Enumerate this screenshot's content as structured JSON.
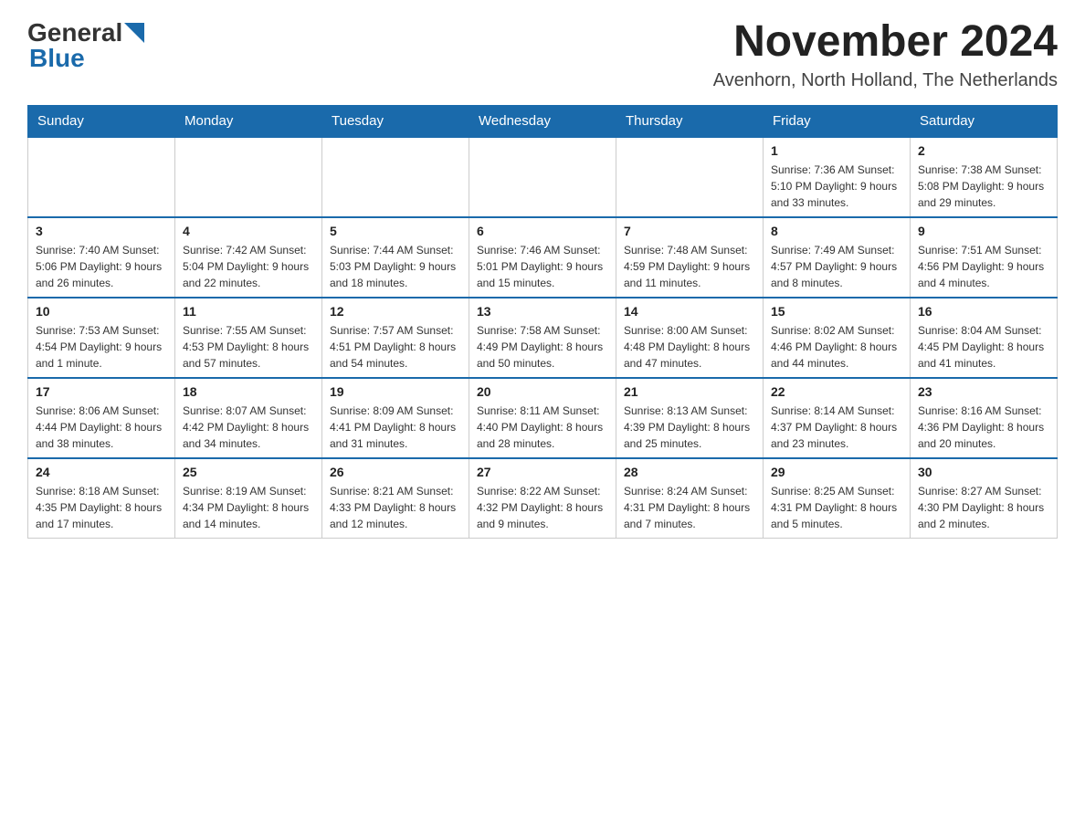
{
  "header": {
    "logo_general": "General",
    "logo_blue": "Blue",
    "month_title": "November 2024",
    "subtitle": "Avenhorn, North Holland, The Netherlands"
  },
  "weekdays": [
    "Sunday",
    "Monday",
    "Tuesday",
    "Wednesday",
    "Thursday",
    "Friday",
    "Saturday"
  ],
  "weeks": [
    {
      "days": [
        {
          "number": "",
          "info": ""
        },
        {
          "number": "",
          "info": ""
        },
        {
          "number": "",
          "info": ""
        },
        {
          "number": "",
          "info": ""
        },
        {
          "number": "",
          "info": ""
        },
        {
          "number": "1",
          "info": "Sunrise: 7:36 AM\nSunset: 5:10 PM\nDaylight: 9 hours and 33 minutes."
        },
        {
          "number": "2",
          "info": "Sunrise: 7:38 AM\nSunset: 5:08 PM\nDaylight: 9 hours and 29 minutes."
        }
      ]
    },
    {
      "days": [
        {
          "number": "3",
          "info": "Sunrise: 7:40 AM\nSunset: 5:06 PM\nDaylight: 9 hours and 26 minutes."
        },
        {
          "number": "4",
          "info": "Sunrise: 7:42 AM\nSunset: 5:04 PM\nDaylight: 9 hours and 22 minutes."
        },
        {
          "number": "5",
          "info": "Sunrise: 7:44 AM\nSunset: 5:03 PM\nDaylight: 9 hours and 18 minutes."
        },
        {
          "number": "6",
          "info": "Sunrise: 7:46 AM\nSunset: 5:01 PM\nDaylight: 9 hours and 15 minutes."
        },
        {
          "number": "7",
          "info": "Sunrise: 7:48 AM\nSunset: 4:59 PM\nDaylight: 9 hours and 11 minutes."
        },
        {
          "number": "8",
          "info": "Sunrise: 7:49 AM\nSunset: 4:57 PM\nDaylight: 9 hours and 8 minutes."
        },
        {
          "number": "9",
          "info": "Sunrise: 7:51 AM\nSunset: 4:56 PM\nDaylight: 9 hours and 4 minutes."
        }
      ]
    },
    {
      "days": [
        {
          "number": "10",
          "info": "Sunrise: 7:53 AM\nSunset: 4:54 PM\nDaylight: 9 hours and 1 minute."
        },
        {
          "number": "11",
          "info": "Sunrise: 7:55 AM\nSunset: 4:53 PM\nDaylight: 8 hours and 57 minutes."
        },
        {
          "number": "12",
          "info": "Sunrise: 7:57 AM\nSunset: 4:51 PM\nDaylight: 8 hours and 54 minutes."
        },
        {
          "number": "13",
          "info": "Sunrise: 7:58 AM\nSunset: 4:49 PM\nDaylight: 8 hours and 50 minutes."
        },
        {
          "number": "14",
          "info": "Sunrise: 8:00 AM\nSunset: 4:48 PM\nDaylight: 8 hours and 47 minutes."
        },
        {
          "number": "15",
          "info": "Sunrise: 8:02 AM\nSunset: 4:46 PM\nDaylight: 8 hours and 44 minutes."
        },
        {
          "number": "16",
          "info": "Sunrise: 8:04 AM\nSunset: 4:45 PM\nDaylight: 8 hours and 41 minutes."
        }
      ]
    },
    {
      "days": [
        {
          "number": "17",
          "info": "Sunrise: 8:06 AM\nSunset: 4:44 PM\nDaylight: 8 hours and 38 minutes."
        },
        {
          "number": "18",
          "info": "Sunrise: 8:07 AM\nSunset: 4:42 PM\nDaylight: 8 hours and 34 minutes."
        },
        {
          "number": "19",
          "info": "Sunrise: 8:09 AM\nSunset: 4:41 PM\nDaylight: 8 hours and 31 minutes."
        },
        {
          "number": "20",
          "info": "Sunrise: 8:11 AM\nSunset: 4:40 PM\nDaylight: 8 hours and 28 minutes."
        },
        {
          "number": "21",
          "info": "Sunrise: 8:13 AM\nSunset: 4:39 PM\nDaylight: 8 hours and 25 minutes."
        },
        {
          "number": "22",
          "info": "Sunrise: 8:14 AM\nSunset: 4:37 PM\nDaylight: 8 hours and 23 minutes."
        },
        {
          "number": "23",
          "info": "Sunrise: 8:16 AM\nSunset: 4:36 PM\nDaylight: 8 hours and 20 minutes."
        }
      ]
    },
    {
      "days": [
        {
          "number": "24",
          "info": "Sunrise: 8:18 AM\nSunset: 4:35 PM\nDaylight: 8 hours and 17 minutes."
        },
        {
          "number": "25",
          "info": "Sunrise: 8:19 AM\nSunset: 4:34 PM\nDaylight: 8 hours and 14 minutes."
        },
        {
          "number": "26",
          "info": "Sunrise: 8:21 AM\nSunset: 4:33 PM\nDaylight: 8 hours and 12 minutes."
        },
        {
          "number": "27",
          "info": "Sunrise: 8:22 AM\nSunset: 4:32 PM\nDaylight: 8 hours and 9 minutes."
        },
        {
          "number": "28",
          "info": "Sunrise: 8:24 AM\nSunset: 4:31 PM\nDaylight: 8 hours and 7 minutes."
        },
        {
          "number": "29",
          "info": "Sunrise: 8:25 AM\nSunset: 4:31 PM\nDaylight: 8 hours and 5 minutes."
        },
        {
          "number": "30",
          "info": "Sunrise: 8:27 AM\nSunset: 4:30 PM\nDaylight: 8 hours and 2 minutes."
        }
      ]
    }
  ]
}
